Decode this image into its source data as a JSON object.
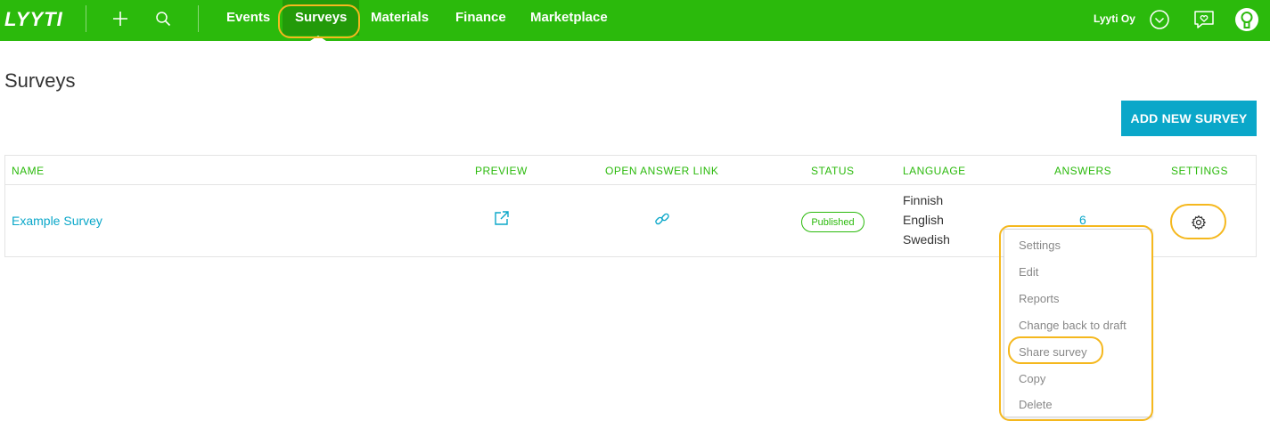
{
  "brand": {
    "logo": "LYYTI",
    "accent": "#2bba0c",
    "link_color": "#0aa7c9"
  },
  "topnav": {
    "add_icon": "plus-icon",
    "search_icon": "search-icon",
    "items": [
      {
        "label": "Events"
      },
      {
        "label": "Surveys",
        "active": true
      },
      {
        "label": "Materials"
      },
      {
        "label": "Finance"
      },
      {
        "label": "Marketplace"
      }
    ],
    "org_name": "Lyyti Oy",
    "org_menu_icon": "chevron-down-circle-icon",
    "feedback_icon": "heart-chat-icon",
    "user_icon": "user-avatar-icon"
  },
  "page": {
    "title": "Surveys",
    "add_button_label": "ADD NEW SURVEY"
  },
  "table": {
    "columns": [
      "NAME",
      "PREVIEW",
      "OPEN ANSWER LINK",
      "STATUS",
      "LANGUAGE",
      "ANSWERS",
      "SETTINGS"
    ],
    "rows": [
      {
        "name": "Example Survey",
        "preview_icon": "external-link-icon",
        "answer_link_icon": "link-icon",
        "status": "Published",
        "languages": [
          "Finnish",
          "English",
          "Swedish"
        ],
        "answers": "6",
        "settings_icon": "gear-icon"
      }
    ]
  },
  "settings_menu": {
    "items": [
      "Settings",
      "Edit",
      "Reports",
      "Change back to draft",
      "Share survey",
      "Copy",
      "Delete"
    ],
    "highlighted": "Share survey"
  }
}
